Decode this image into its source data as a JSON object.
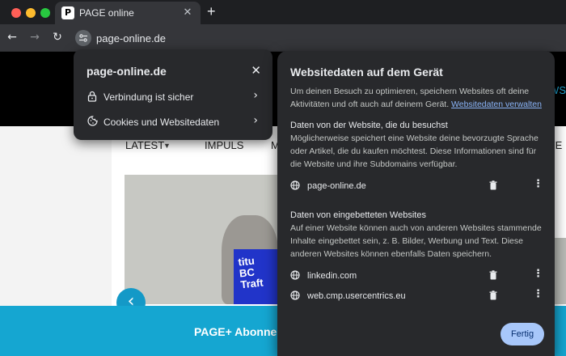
{
  "browser": {
    "tab": {
      "title": "PAGE online",
      "favicon": "P"
    },
    "new_tab_label": "+",
    "url": "page-online.de"
  },
  "page": {
    "header_fragment": "WS",
    "nav": {
      "latest": "LATEST",
      "impuls": "IMPULS",
      "m": "M",
      "right": "YE"
    },
    "hero_text": "titu\nBC\nTraft",
    "banner": "PAGE+ Abonne"
  },
  "site_info": {
    "title": "page-online.de",
    "rows": [
      {
        "label": "Verbindung ist sicher",
        "icon": "lock-icon"
      },
      {
        "label": "Cookies und Websitedaten",
        "icon": "cookie-icon"
      }
    ]
  },
  "site_data_dialog": {
    "title": "Websitedaten auf dem Gerät",
    "intro": "Um deinen Besuch zu optimieren, speichern Websites oft deine Aktivitäten und oft auch auf deinem Gerät.",
    "manage_link": "Websitedaten verwalten",
    "visited_section": {
      "title": "Daten von der Website, die du besuchst",
      "text": "Möglicherweise speichert eine Website deine bevorzugte Sprache oder Artikel, die du kaufen möchtest. Diese Informationen sind für die Website und ihre Subdomains verfügbar.",
      "sites": [
        "page-online.de"
      ]
    },
    "embedded_section": {
      "title": "Daten von eingebetteten Websites",
      "text": "Auf einer Website können auch von anderen Websites stammende Inhalte eingebettet sein, z. B. Bilder, Werbung und Text. Diese anderen Websites können ebenfalls Daten speichern.",
      "sites": [
        "linkedin.com",
        "web.cmp.usercentrics.eu"
      ]
    },
    "done_label": "Fertig"
  },
  "colors": {
    "accent": "#a8c7fa",
    "link": "#8ab4f8",
    "popup_bg": "#28292c",
    "banner": "#15a6d1"
  }
}
